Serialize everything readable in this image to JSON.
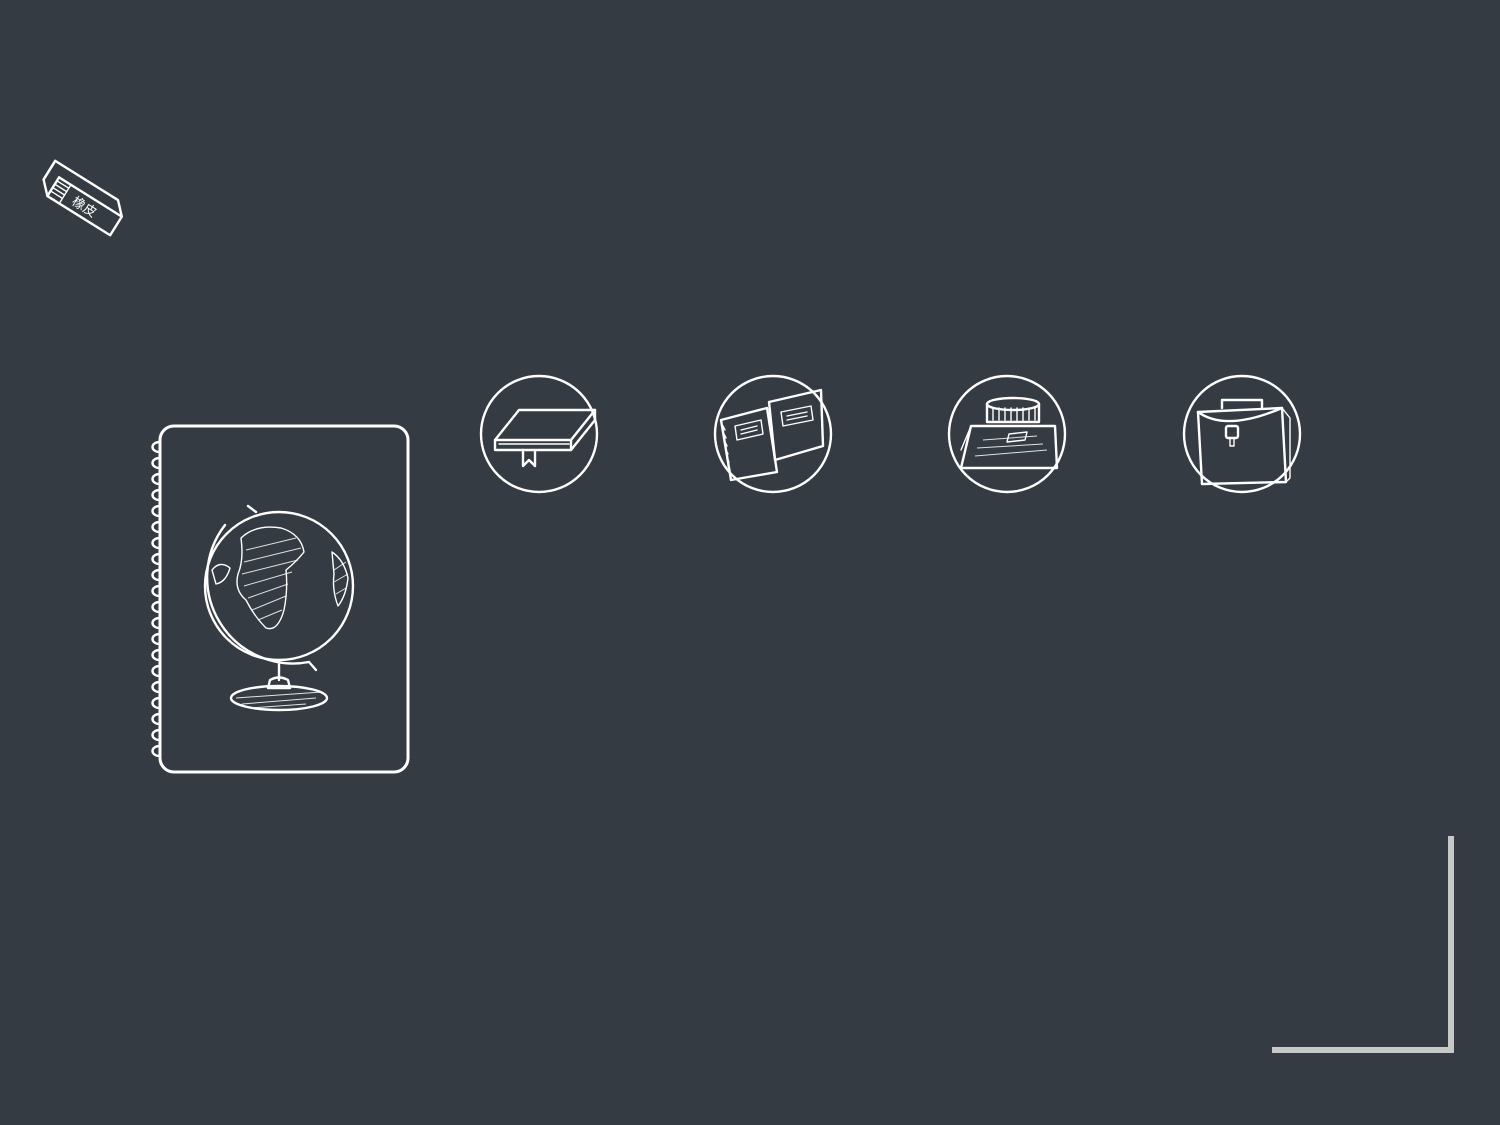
{
  "slide": {
    "background_color": "#353b42",
    "line_color": "#ffffff",
    "corner_bracket_color": "#c8c8c8"
  },
  "eraser": {
    "icon": "eraser-icon",
    "label": "橡皮"
  },
  "notebook": {
    "icon": "spiral-notebook-icon",
    "illustration": "globe-icon"
  },
  "circle_icons": [
    {
      "icon": "book-icon"
    },
    {
      "icon": "notebooks-icon"
    },
    {
      "icon": "ink-bottle-icon"
    },
    {
      "icon": "briefcase-icon"
    }
  ],
  "corner_decoration": {
    "icon": "corner-bracket"
  }
}
